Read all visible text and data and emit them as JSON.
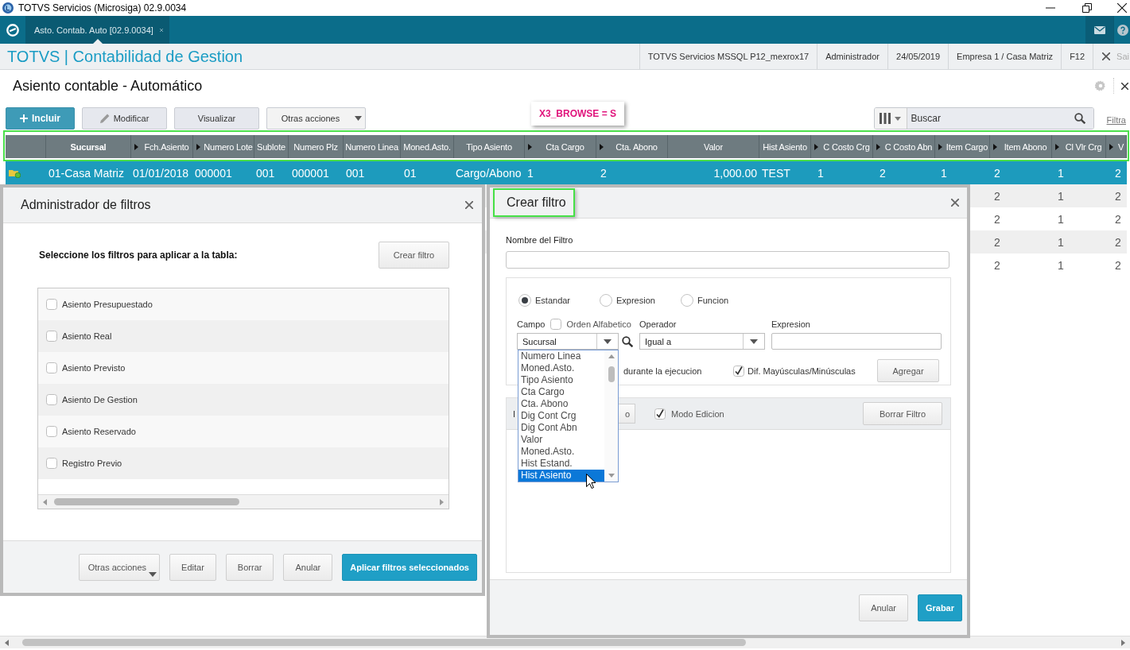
{
  "window": {
    "title": "TOTVS Servicios (Microsiga) 02.9.0034"
  },
  "tabs": [
    {
      "label": "Asto. Contab. Auto [02.9.0034]",
      "selected": true
    }
  ],
  "header": {
    "app_title": "TOTVS | Contabilidad de Gestion",
    "info": [
      "TOTVS Servicios MSSQL P12_mexrox17",
      "Administrador",
      "24/05/2019",
      "Empresa 1 / Casa Matriz",
      "F12"
    ],
    "exit_label": "Sai"
  },
  "page": {
    "title": "Asiento contable - Automático"
  },
  "toolbar": {
    "buttons": [
      {
        "label": "Incluir",
        "kind": "add"
      },
      {
        "label": "Modificar",
        "kind": "edit"
      },
      {
        "label": "Visualizar",
        "kind": "plain"
      },
      {
        "label": "Otras acciones",
        "kind": "menu"
      }
    ],
    "search": {
      "placeholder": "Buscar"
    },
    "filter_link": "Filtra"
  },
  "annotation": {
    "text": "X3_BROWSE = S"
  },
  "table": {
    "columns": [
      {
        "label": "Sucursal",
        "arrow": false,
        "sorted": true
      },
      {
        "label": "Fch.Asiento",
        "arrow": true,
        "sorted": false
      },
      {
        "label": "Numero Lote",
        "arrow": true,
        "sorted": false
      },
      {
        "label": "Sublote",
        "arrow": false,
        "sorted": false
      },
      {
        "label": "Numero Plz",
        "arrow": false,
        "sorted": false
      },
      {
        "label": "Numero Linea",
        "arrow": false,
        "sorted": false
      },
      {
        "label": "Moned.Asto.",
        "arrow": false,
        "sorted": false
      },
      {
        "label": "Tipo Asiento",
        "arrow": false,
        "sorted": false
      },
      {
        "label": "Cta Cargo",
        "arrow": true,
        "sorted": false
      },
      {
        "label": "Cta. Abono",
        "arrow": true,
        "sorted": false
      },
      {
        "label": "Valor",
        "arrow": false,
        "sorted": false
      },
      {
        "label": "Hist Asiento",
        "arrow": false,
        "sorted": false
      },
      {
        "label": "C Costo Crg",
        "arrow": true,
        "sorted": false
      },
      {
        "label": "C Costo Abn",
        "arrow": true,
        "sorted": false
      },
      {
        "label": "Item Cargo",
        "arrow": true,
        "sorted": false
      },
      {
        "label": "Item Abono",
        "arrow": true,
        "sorted": false
      },
      {
        "label": "Cl Vlr Crg",
        "arrow": true,
        "sorted": false
      },
      {
        "label": "V",
        "arrow": true,
        "sorted": false
      }
    ],
    "rows": [
      {
        "selected": true,
        "cells": [
          "01-Casa Matriz",
          "01/01/2018",
          "000001",
          "001",
          "000001",
          "001",
          "01",
          "Cargo/Abono",
          "1",
          "2",
          "1,000.00",
          "TEST",
          "1",
          "2",
          "1",
          "2",
          "1",
          "2"
        ]
      },
      {
        "selected": false,
        "cells": [
          "",
          "",
          "",
          "",
          "",
          "",
          "",
          "",
          "",
          "",
          "",
          "",
          "",
          "",
          "",
          "2",
          "1",
          "2"
        ]
      },
      {
        "selected": false,
        "cells": [
          "",
          "",
          "",
          "",
          "",
          "",
          "",
          "",
          "",
          "",
          "",
          "",
          "",
          "",
          "",
          "2",
          "1",
          "2"
        ]
      },
      {
        "selected": false,
        "cells": [
          "",
          "",
          "",
          "",
          "",
          "",
          "",
          "",
          "",
          "",
          "",
          "",
          "",
          "",
          "",
          "2",
          "1",
          "2"
        ]
      },
      {
        "selected": false,
        "cells": [
          "",
          "",
          "",
          "",
          "",
          "",
          "",
          "",
          "",
          "",
          "",
          "",
          "",
          "",
          "",
          "2",
          "1",
          "2"
        ]
      }
    ]
  },
  "filter_manager": {
    "title": "Administrador de filtros",
    "instruction": "Seleccione los filtros para aplicar a la tabla:",
    "create_button": "Crear filtro",
    "filters": [
      {
        "label": "Asiento Presupuestado",
        "checked": false
      },
      {
        "label": "Asiento Real",
        "checked": false
      },
      {
        "label": "Asiento Previsto",
        "checked": false
      },
      {
        "label": "Asiento De Gestion",
        "checked": false
      },
      {
        "label": "Asiento Reservado",
        "checked": false
      },
      {
        "label": "Registro Previo",
        "checked": false
      }
    ],
    "buttons": [
      {
        "label": "Otras acciones",
        "kind": "menu"
      },
      {
        "label": "Editar",
        "kind": "plain"
      },
      {
        "label": "Borrar",
        "kind": "plain"
      },
      {
        "label": "Anular",
        "kind": "plain"
      },
      {
        "label": "Aplicar filtros seleccionados",
        "kind": "primary"
      }
    ]
  },
  "create_filter": {
    "title": "Crear filtro",
    "name_label": "Nombre del Filtro",
    "modes": [
      {
        "label": "Estandar",
        "selected": true
      },
      {
        "label": "Expresion",
        "selected": false
      },
      {
        "label": "Funcion",
        "selected": false
      }
    ],
    "field_label": "Campo",
    "alphabetic": {
      "label": "Orden Alfabetico",
      "checked": false
    },
    "field_value": "Sucursal",
    "operator_label": "Operador",
    "operator_value": "Igual a",
    "expression_label": "Expresion",
    "ask_label": "durante la ejecucion",
    "case_option": {
      "label": "Dif. Mayúsculas/Minúsculas",
      "checked": true
    },
    "add_button": "Agregar",
    "list_bar": {
      "text": "I",
      "button": "o",
      "edit_mode": {
        "label": "Modo Edicion",
        "checked": true
      },
      "clear_button": "Borrar Filtro"
    },
    "field_dropdown": {
      "items": [
        {
          "label": "Numero Linea",
          "selected": false
        },
        {
          "label": "Moned.Asto.",
          "selected": false
        },
        {
          "label": "Tipo Asiento",
          "selected": false
        },
        {
          "label": "Cta Cargo",
          "selected": false
        },
        {
          "label": "Cta. Abono",
          "selected": false
        },
        {
          "label": "Dig Cont Crg",
          "selected": false
        },
        {
          "label": "Dig Cont Abn",
          "selected": false
        },
        {
          "label": "Valor",
          "selected": false
        },
        {
          "label": "Moned.Asto.",
          "selected": false
        },
        {
          "label": "Hist Estand.",
          "selected": false
        },
        {
          "label": "Hist Asiento",
          "selected": true
        }
      ]
    },
    "buttons": [
      {
        "label": "Anular",
        "kind": "plain"
      },
      {
        "label": "Grabar",
        "kind": "primary"
      }
    ]
  }
}
